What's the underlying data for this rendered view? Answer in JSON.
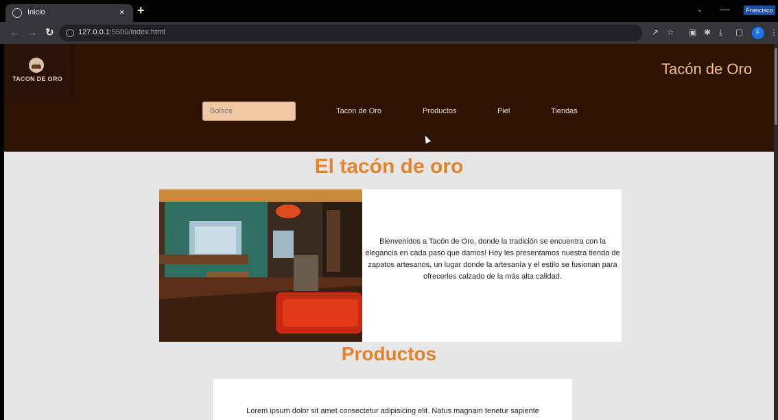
{
  "browser": {
    "tab_title": "Inicio",
    "tab_close": "×",
    "new_tab": "+",
    "profile_badge": "Francisco",
    "url_host": "127.0.0.1",
    "url_rest": ":5500/index.html",
    "avatar_initial": "F"
  },
  "header": {
    "logo_text": "TACON DE ORO",
    "site_title": "Tacón de Oro",
    "search_placeholder": "Bolsos",
    "nav": [
      "Tacon de Oro",
      "Productos",
      "Piel",
      "Tiendas"
    ]
  },
  "main": {
    "heading": "El tacón de oro",
    "intro": "Bienvenidos a Tacón de Oro, donde la tradición se encuentra con la elegancia en cada paso que damos! Hoy les presentamos nuestra tienda de zapatos artesanos, un lugar donde la artesanía y el estilo se fusionan para ofrecerles calzado de la más alta calidad.",
    "products_heading": "Productos",
    "products_text": "Lorem ipsum dolor sit amet consectetur adipisicing elit. Natus magnam tenetur sapiente"
  },
  "colors": {
    "header_bg": "#2e1305",
    "accent": "#e2842b",
    "page_bg": "#e6e6e6",
    "search_bg": "#f1c8a4"
  },
  "icons": [
    "browser-tab-favicon-icon",
    "back-arrow-icon",
    "forward-arrow-icon",
    "reload-icon",
    "info-icon",
    "share-icon",
    "star-icon",
    "extensions-icon",
    "download-icon",
    "sidepanel-icon",
    "menu-dots-icon"
  ]
}
